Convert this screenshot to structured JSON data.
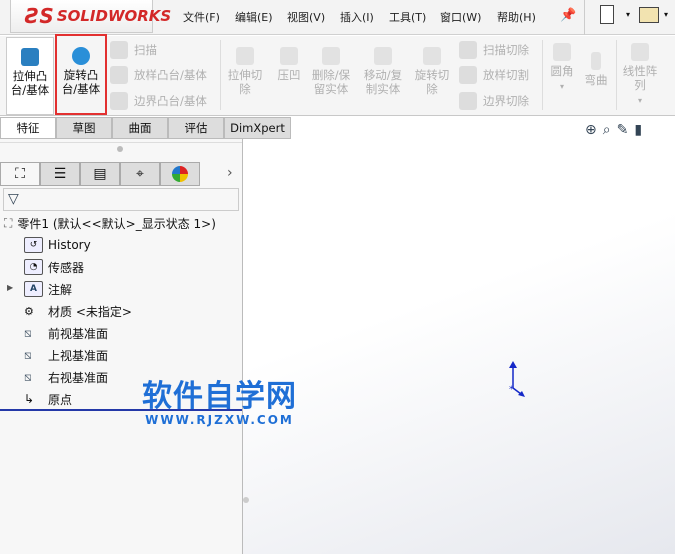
{
  "app": {
    "logo": "SOLIDWORKS"
  },
  "menu": [
    "文件(F)",
    "编辑(E)",
    "视图(V)",
    "插入(I)",
    "工具(T)",
    "窗口(W)",
    "帮助(H)"
  ],
  "toolbar": {
    "extrude_boss": "拉伸凸台/基体",
    "revolve_boss": "旋转凸台/基体",
    "sweep": "扫描",
    "loft": "放样凸台/基体",
    "boundary": "边界凸台/基体",
    "extrude_cut": "拉伸切除",
    "indent": "压凹",
    "delete_body": "删除/保留实体",
    "move_copy": "移动/复制实体",
    "revolve_cut": "旋转切除",
    "sweep_cut": "扫描切除",
    "loft_cut": "放样切割",
    "boundary_cut": "边界切除",
    "fillet": "圆角",
    "flex": "弯曲",
    "linear_pattern": "线性阵列"
  },
  "tabs": [
    "特征",
    "草图",
    "曲面",
    "评估",
    "DimXpert"
  ],
  "tree": {
    "root": "零件1  (默认<<默认>_显示状态 1>)",
    "items": [
      "History",
      "传感器",
      "注解",
      "材质 <未指定>",
      "前视基准面",
      "上视基准面",
      "右视基准面",
      "原点"
    ]
  },
  "watermark": {
    "title": "软件自学网",
    "url": "WWW.RJZXW.COM"
  },
  "colors": {
    "highlight": "#e23030",
    "logo": "#d32828",
    "accent": "#1f6fd6"
  }
}
